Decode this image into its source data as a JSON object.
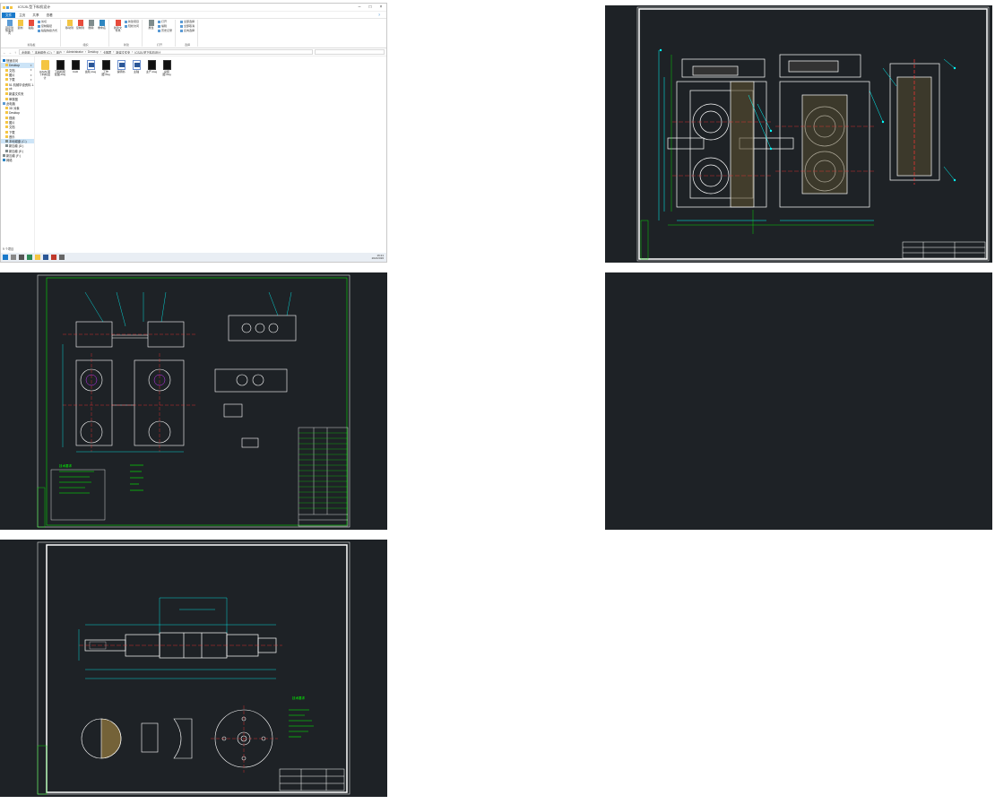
{
  "explorer": {
    "title": "ICSJ5-型下料机设计",
    "ribbon_tabs": [
      "文件",
      "主页",
      "共享",
      "查看"
    ],
    "ribbon_groups": [
      {
        "label": "剪贴板",
        "items": [
          "固定到快速访问",
          "复制",
          "粘贴"
        ],
        "small": [
          "剪切",
          "复制路径",
          "粘贴快捷方式"
        ]
      },
      {
        "label": "组织",
        "items": [
          "移动到",
          "复制到",
          "删除",
          "重命名"
        ],
        "small": []
      },
      {
        "label": "新建",
        "items": [
          "新建文件夹"
        ],
        "small": [
          "新建项目",
          "轻松访问"
        ]
      },
      {
        "label": "打开",
        "items": [
          "属性"
        ],
        "small": [
          "打开",
          "编辑",
          "历史记录"
        ]
      },
      {
        "label": "选择",
        "items": [],
        "small": [
          "全部选择",
          "全部取消",
          "反向选择"
        ]
      }
    ],
    "address_path": [
      "此电脑",
      "本地磁盘 (C:)",
      "用户",
      "Administrator",
      "Desktop",
      "卡丽君",
      "新建文件夹",
      "ICSJ5-型下料机设计"
    ],
    "search_placeholder": "",
    "nav_items": [
      {
        "label": "快速访问",
        "type": "star",
        "indent": false
      },
      {
        "label": "Desktop",
        "type": "folder",
        "indent": true,
        "selected": true,
        "pin": "★"
      },
      {
        "label": "文档",
        "type": "folder",
        "indent": true,
        "pin": "★"
      },
      {
        "label": "图片",
        "type": "folder",
        "indent": true,
        "pin": "★"
      },
      {
        "label": "下载",
        "type": "folder",
        "indent": true,
        "pin": "★"
      },
      {
        "label": "51 机械毕设资料 1.2年",
        "type": "folder",
        "indent": true
      },
      {
        "label": "ok",
        "type": "folder",
        "indent": true
      },
      {
        "label": "新建文件夹",
        "type": "folder",
        "indent": true
      },
      {
        "label": "审核图",
        "type": "folder",
        "indent": true
      },
      {
        "label": "此电脑",
        "type": "pc",
        "indent": false
      },
      {
        "label": "3D 对象",
        "type": "folder",
        "indent": true
      },
      {
        "label": "Desktop",
        "type": "folder",
        "indent": true
      },
      {
        "label": "视频",
        "type": "folder",
        "indent": true
      },
      {
        "label": "图片",
        "type": "folder",
        "indent": true
      },
      {
        "label": "文档",
        "type": "folder",
        "indent": true
      },
      {
        "label": "下载",
        "type": "folder",
        "indent": true
      },
      {
        "label": "音乐",
        "type": "folder",
        "indent": true
      },
      {
        "label": "本地磁盘 (C:)",
        "type": "drive",
        "indent": true,
        "selected2": true
      },
      {
        "label": "新加卷 (D:)",
        "type": "drive",
        "indent": true
      },
      {
        "label": "新加卷 (E:)",
        "type": "drive",
        "indent": true
      },
      {
        "label": "新加卷 (F:)",
        "type": "drive",
        "indent": false
      },
      {
        "label": "网络",
        "type": "net",
        "indent": false
      }
    ],
    "files": [
      {
        "name": "ICSJ5-型下料机设计",
        "type": "folder"
      },
      {
        "name": "下料机装配图.dwg",
        "type": "dwg"
      },
      {
        "name": "CAD",
        "type": "dwg"
      },
      {
        "name": "齿轮.dwg",
        "type": "doc"
      },
      {
        "name": "工作图.dwg",
        "type": "dwg"
      },
      {
        "name": "说明书",
        "type": "doc"
      },
      {
        "name": "主轴",
        "type": "doc"
      },
      {
        "name": "主产.dwg",
        "type": "dwg"
      },
      {
        "name": "总装图.dwg",
        "type": "dwg"
      }
    ],
    "status": "9 个项目",
    "tray_time": "16:21",
    "tray_date": "2021/3/26"
  },
  "drawings": [
    {
      "name": "gearbox-assembly-drawing"
    },
    {
      "name": "feeder-assembly-drawing"
    },
    {
      "name": "blank-drawing"
    },
    {
      "name": "shaft-part-drawing"
    }
  ],
  "drawing_text": {
    "shaft_note_title": "技术要求",
    "assembly_note_title": "技术要求"
  }
}
